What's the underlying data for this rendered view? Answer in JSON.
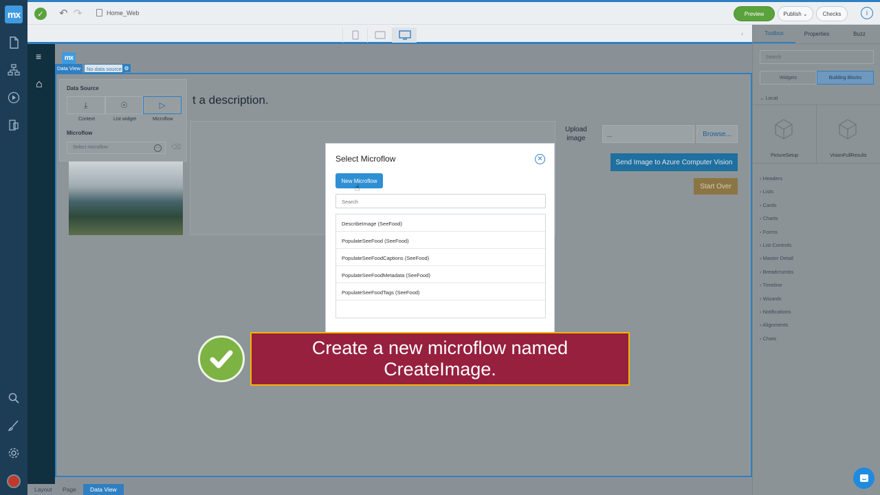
{
  "app": {
    "logo": "mx",
    "document": "Home_Web"
  },
  "topbar": {
    "preview": "Preview",
    "publish": "Publish",
    "checks": "Checks",
    "info": "i"
  },
  "leftnav": {
    "icons": [
      "file-icon",
      "sitemap-icon",
      "play-icon",
      "mobile-icon",
      "search-icon",
      "brush-icon",
      "settings-icon"
    ]
  },
  "canvas": {
    "hamburger": "≡",
    "mx_tag": "mx",
    "dataview_tag": "Data View",
    "datasource_tag": "No data source",
    "desc_text": "t a description.",
    "upload_label_1": "Upload",
    "upload_label_2": "image",
    "upload_value": "...",
    "browse": "Browse...",
    "send": "Send Image to Azure Computer Vision",
    "start_over": "Start Over"
  },
  "datasource_popover": {
    "title": "Data Source",
    "options": [
      "Context",
      "List widget",
      "Microflow"
    ],
    "selected": "Microflow",
    "microflow_label": "Microflow",
    "microflow_placeholder": "Select microflow"
  },
  "modal": {
    "title": "Select Microflow",
    "new_button": "New Microflow",
    "search_placeholder": "Search",
    "items": [
      "DescribeImage (SeeFood)",
      "PopulateSeeFood (SeeFood)",
      "PopulateSeeFoodCaptions (SeeFood)",
      "PopulateSeeFoodMetadata (SeeFood)",
      "PopulateSeeFoodTags (SeeFood)"
    ]
  },
  "callout": {
    "line1": "Create a new microflow named",
    "line2": "CreateImage."
  },
  "statusbar": {
    "crumbs": [
      "Layout",
      "Page",
      "Data View"
    ]
  },
  "rightpanel": {
    "tabs": [
      "Toolbox",
      "Properties",
      "Buzz"
    ],
    "search_placeholder": "Search",
    "toggle": [
      "Widgets",
      "Building Blocks"
    ],
    "local_label": "Local",
    "tiles": [
      "PictureSetup",
      "VisionFullResults"
    ],
    "categories": [
      "Headers",
      "Lists",
      "Cards",
      "Charts",
      "Forms",
      "List Controls",
      "Master Detail",
      "Breadcrumbs",
      "Timeline",
      "Wizards",
      "Notifications",
      "Alignments",
      "Chats"
    ]
  }
}
